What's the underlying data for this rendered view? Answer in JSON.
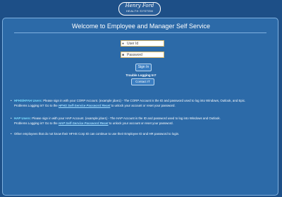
{
  "logo": {
    "line1": "Henry Ford",
    "line2": "HEALTH SYSTEM"
  },
  "title": "Welcome to Employee and Manager Self Service",
  "login": {
    "user_placeholder": "User Id",
    "pass_placeholder": "Password",
    "signin_label": "Sign In",
    "trouble_text": "Trouble Logging In?",
    "contact_label": "Contact IT"
  },
  "notes": {
    "n1": {
      "heading": "HFHS/HFAH Users:",
      "text1": " Please sign in with your CORP Account. (example jdoe1) - The CORP Account is the ID and password used to log into Windows, Outlook, and Epic.",
      "text2": "Problems Logging in? Go to the ",
      "link": "HFHS Self-Service Password Reset",
      "text3": " to unlock your account or reset your password."
    },
    "n2": {
      "heading": "HAP Users:",
      "text1": " Please sign in with your HAP Account. (example jdoe1) - The HAP Account is the ID and password used to log into Windows and Outlook.",
      "text2": "Problems Logging in? Go to the ",
      "link": "HAP Self-Service Password Reset",
      "text3": " to unlock your account or reset your password."
    },
    "n3": {
      "text": "Other employees that do not know their HFHS Corp ID can continue to use their Employee ID and HR password to login."
    }
  },
  "colors": {
    "background": "#1d4f87",
    "panel": "#2c6aa8",
    "accent": "#7fe0ff"
  }
}
